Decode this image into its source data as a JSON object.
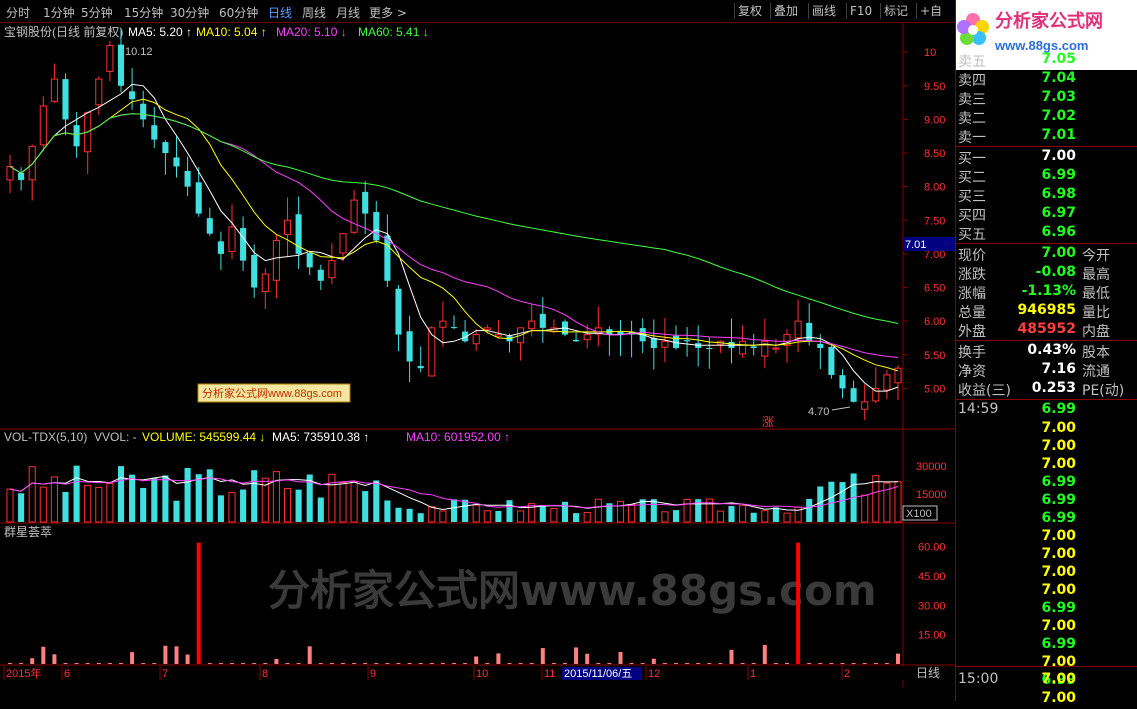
{
  "topbar": {
    "timeframes": [
      "分时",
      "1分钟",
      "5分钟",
      "15分钟",
      "30分钟",
      "60分钟",
      "日线",
      "周线",
      "月线",
      "更多 >"
    ],
    "active": "日线",
    "right_buttons": [
      "复权",
      "叠加",
      "画线",
      "F10",
      "标记",
      "+自"
    ]
  },
  "logo": {
    "brand": "分析家公式网",
    "url": "www.88gs.com"
  },
  "main_chart": {
    "title": "宝钢股份(日线 前复权)",
    "indicators": [
      {
        "label": "MA5: 5.20",
        "arrow": "↑",
        "color": "#ffffff"
      },
      {
        "label": "MA10: 5.04",
        "arrow": "↑",
        "color": "#ffff00"
      },
      {
        "label": "MA20: 5.10",
        "arrow": "↓",
        "color": "#ff40ff"
      },
      {
        "label": "MA60: 5.41",
        "arrow": "↓",
        "color": "#40ff40"
      }
    ],
    "high_label": "10.12",
    "low_label": "4.70",
    "current_price_tag": "7.01",
    "watermark_small": "分析家公式网www.88gs.com",
    "rise_mark": "涨",
    "y_ticks": [
      "10",
      "9.50",
      "9.00",
      "8.50",
      "8.00",
      "7.50",
      "7.00",
      "6.50",
      "6.00",
      "5.50",
      "5.00"
    ]
  },
  "volume_panel": {
    "title": "VOL-TDX(5,10)",
    "items": [
      {
        "label": "VVOL: -",
        "color": "#c0c0c0"
      },
      {
        "label": "VOLUME: 545599.44",
        "arrow": "↓",
        "color": "#ffff00"
      },
      {
        "label": "MA5: 735910.38",
        "arrow": "↑",
        "color": "#ffffff"
      },
      {
        "label": "MA10: 601952.00",
        "arrow": "↑",
        "color": "#ff40ff"
      }
    ],
    "y_ticks": [
      "30000",
      "15000"
    ],
    "multiplier": "X100"
  },
  "indicator_panel": {
    "title": "群星荟萃",
    "y_ticks": [
      "60.00",
      "45.00",
      "30.00",
      "15.00"
    ],
    "watermark": "分析家公式网www.88gs.com"
  },
  "x_axis": {
    "labels": [
      "2015年",
      "6",
      "7",
      "8",
      "9",
      "10",
      "11",
      "12",
      "1",
      "2"
    ],
    "cursor_date": "2015/11/06/五",
    "period": "日线"
  },
  "quote": {
    "sell": [
      {
        "label": "卖五",
        "price": "7.05"
      },
      {
        "label": "卖四",
        "price": "7.04"
      },
      {
        "label": "卖三",
        "price": "7.03"
      },
      {
        "label": "卖二",
        "price": "7.02"
      },
      {
        "label": "卖一",
        "price": "7.01"
      }
    ],
    "buy": [
      {
        "label": "买一",
        "price": "7.00"
      },
      {
        "label": "买二",
        "price": "6.99"
      },
      {
        "label": "买三",
        "price": "6.98"
      },
      {
        "label": "买四",
        "price": "6.97"
      },
      {
        "label": "买五",
        "price": "6.96"
      }
    ],
    "stats": [
      {
        "label": "现价",
        "value": "7.00",
        "right": "今开",
        "color": "#20ff20"
      },
      {
        "label": "涨跌",
        "value": "-0.08",
        "right": "最高",
        "color": "#20ff20"
      },
      {
        "label": "涨幅",
        "value": "-1.13%",
        "right": "最低",
        "color": "#20ff20"
      },
      {
        "label": "总量",
        "value": "946985",
        "right": "量比",
        "color": "#ffff00"
      },
      {
        "label": "外盘",
        "value": "485952",
        "right": "内盘",
        "color": "#ff4040"
      }
    ],
    "stats2": [
      {
        "label": "换手",
        "value": "0.43%",
        "right": "股本"
      },
      {
        "label": "净资",
        "value": "7.16",
        "right": "流通"
      },
      {
        "label": "收益(三)",
        "value": "0.253",
        "right": "PE(动)"
      }
    ],
    "ticks_header": {
      "time": "14:59",
      "price": "6.99"
    },
    "ticks": [
      "7.00",
      "7.00",
      "7.00",
      "6.99",
      "6.99",
      "6.99",
      "7.00",
      "7.00",
      "7.00",
      "7.00",
      "6.99",
      "7.00",
      "6.99",
      "7.00",
      "6.99",
      "7.00"
    ],
    "ticks_footer": {
      "time": "15:00",
      "price": "7.00"
    }
  },
  "chart_data": {
    "type": "candlestick",
    "title": "宝钢股份(日线 前复权)",
    "ylim": [
      4.5,
      10.3
    ],
    "close_series": [
      8.3,
      8.1,
      8.6,
      9.2,
      9.6,
      9.0,
      8.6,
      9.1,
      9.6,
      10.1,
      9.5,
      9.3,
      9.0,
      8.7,
      8.5,
      8.3,
      8.0,
      7.6,
      7.3,
      7.0,
      7.4,
      6.9,
      6.5,
      6.7,
      7.2,
      7.5,
      7.0,
      6.8,
      6.6,
      6.9,
      7.3,
      7.8,
      7.6,
      7.2,
      6.6,
      5.8,
      5.4,
      5.3,
      5.9,
      6.0,
      5.9,
      5.7,
      5.8,
      5.9,
      5.8,
      5.7,
      5.9,
      6.0,
      5.9,
      5.9,
      5.8,
      5.7,
      5.8,
      5.9,
      5.8,
      5.8,
      5.8,
      5.7,
      5.6,
      5.7,
      5.6,
      5.7,
      5.6,
      5.6,
      5.7,
      5.6,
      5.7,
      5.6,
      5.7,
      5.6,
      5.8,
      6.0,
      5.7,
      5.6,
      5.2,
      5.0,
      4.8,
      4.8,
      5.0,
      5.2,
      5.3
    ],
    "volume_ticks": [
      30000,
      15000
    ],
    "indicator_ticks": [
      60,
      45,
      30,
      15
    ]
  }
}
